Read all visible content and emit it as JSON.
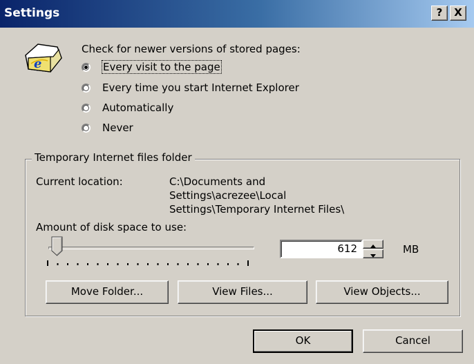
{
  "window": {
    "title": "Settings",
    "help_button": "?",
    "close_button": "X"
  },
  "check_section": {
    "label": "Check for newer versions of stored pages:",
    "options": [
      {
        "label": "Every visit to the page",
        "selected": true
      },
      {
        "label": "Every time you start Internet Explorer",
        "selected": false
      },
      {
        "label": "Automatically",
        "selected": false
      },
      {
        "label": "Never",
        "selected": false
      }
    ]
  },
  "temp_folder": {
    "group_label": "Temporary Internet files folder",
    "location_label": "Current location:",
    "location_lines": [
      "C:\\Documents and",
      "Settings\\acrezee\\Local",
      "Settings\\Temporary Internet Files\\"
    ],
    "disk_space_label": "Amount of disk space to use:",
    "disk_space_value": "612",
    "disk_space_unit": "MB",
    "slider_fraction": 0.04,
    "buttons": {
      "move_folder": "Move Folder...",
      "view_files": "View Files...",
      "view_objects": "View Objects..."
    }
  },
  "footer": {
    "ok": "OK",
    "cancel": "Cancel"
  },
  "icons": [
    "ie-folder-icon",
    "radio-icon",
    "slider-thumb-icon",
    "spin-up-icon",
    "spin-down-icon"
  ]
}
